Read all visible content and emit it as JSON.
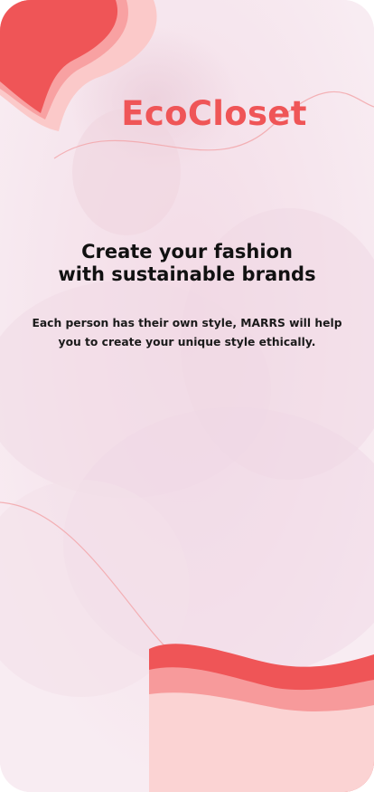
{
  "app": {
    "brand": "EcoCloset"
  },
  "onboarding": {
    "headline_line1": "Create your fashion",
    "headline_line2": "with sustainable brands",
    "description_line1": "Each person has their own style, MARRS will help",
    "description_line2": "you to create your unique style ethically."
  },
  "colors": {
    "accent": "#ef5557",
    "accent_light": "#f79a9b",
    "accent_pale": "#fbc9c9",
    "background_tint": "#f8e9ef",
    "text": "#111111"
  },
  "icons": {
    "decor_top": "blob-shape",
    "decor_bottom": "wave-shape"
  }
}
